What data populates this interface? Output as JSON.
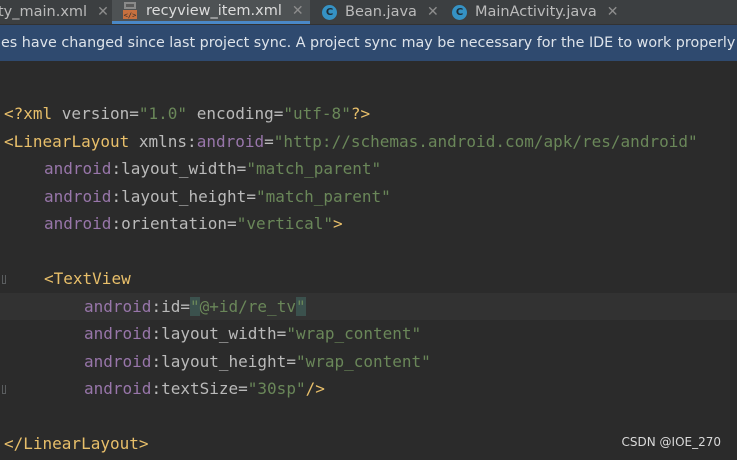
{
  "tabs": [
    {
      "label": "ty_main.xml",
      "icon": "xml-file-icon",
      "active": false
    },
    {
      "label": "recyview_item.xml",
      "icon": "xml-layout-icon",
      "active": true
    },
    {
      "label": "Bean.java",
      "icon": "java-class-icon",
      "active": false
    },
    {
      "label": "MainActivity.java",
      "icon": "java-class-icon",
      "active": false
    }
  ],
  "close_glyph": "✕",
  "class_icon_letter": "C",
  "banner": {
    "text": "les have changed since last project sync. A project sync may be necessary for the IDE to work properly"
  },
  "code": {
    "line1": {
      "open": "<?",
      "name": "xml ",
      "a1": "version",
      "eq1": "=",
      "v1": "\"1.0\"",
      "sp": " ",
      "a2": "encoding",
      "eq2": "=",
      "v2": "\"utf-8\"",
      "close": "?>"
    },
    "line2": {
      "open": "<",
      "tag": "LinearLayout",
      "sp": " ",
      "xmlns": "xmlns",
      "colon": ":",
      "ns": "android",
      "eq": "=",
      "val": "\"http://schemas.android.com/apk/res/android\""
    },
    "line3": {
      "ns": "android",
      "colon": ":",
      "attr": "layout_width",
      "eq": "=",
      "val": "\"match_parent\""
    },
    "line4": {
      "ns": "android",
      "colon": ":",
      "attr": "layout_height",
      "eq": "=",
      "val": "\"match_parent\""
    },
    "line5": {
      "ns": "android",
      "colon": ":",
      "attr": "orientation",
      "eq": "=",
      "val": "\"vertical\"",
      "close": ">"
    },
    "line7": {
      "open": "<",
      "tag": "TextView"
    },
    "line8": {
      "ns": "android",
      "colon": ":",
      "attr": "id",
      "eq": "=",
      "q1": "\"",
      "val": "@+id/re_tv",
      "q2": "\""
    },
    "line9": {
      "ns": "android",
      "colon": ":",
      "attr": "layout_width",
      "eq": "=",
      "val": "\"wrap_content\""
    },
    "line10": {
      "ns": "android",
      "colon": ":",
      "attr": "layout_height",
      "eq": "=",
      "val": "\"wrap_content\""
    },
    "line11": {
      "ns": "android",
      "colon": ":",
      "attr": "textSize",
      "eq": "=",
      "val": "\"30sp\"",
      "close": "/>"
    },
    "line13": {
      "open": "</",
      "tag": "LinearLayout",
      "close": ">"
    }
  },
  "watermark": "CSDN @IOE_270",
  "colors": {
    "background": "#2b2b2b",
    "tag": "#e8bf6a",
    "namespace": "#9876aa",
    "attribute": "#bababa",
    "string": "#6a8759",
    "banner": "#2f4a6f",
    "tab_accent": "#4a88c7"
  }
}
